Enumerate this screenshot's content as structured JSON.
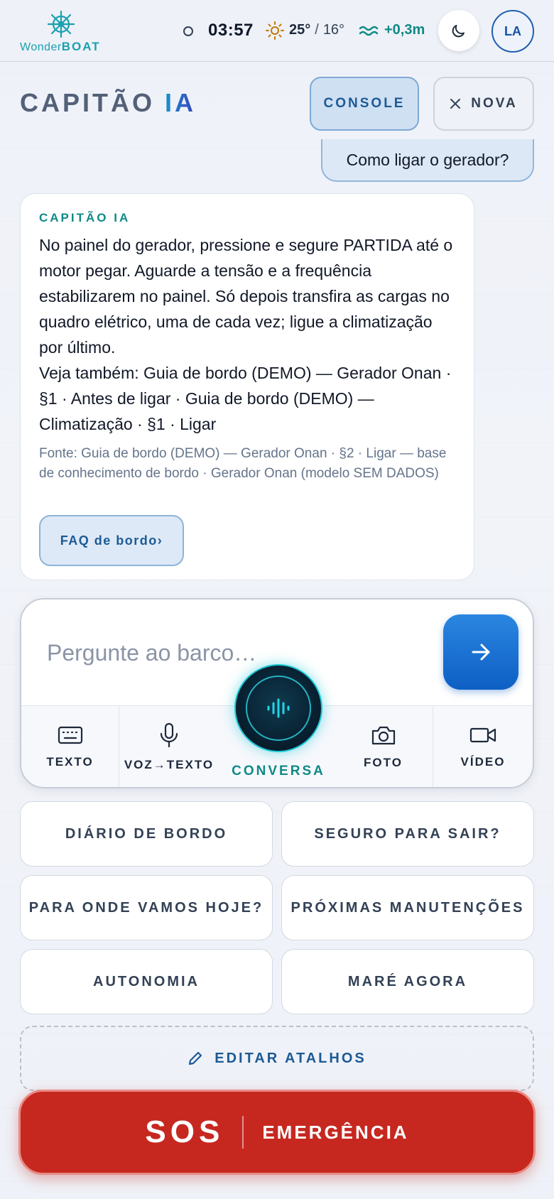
{
  "header": {
    "brand_prefix": "Wonder",
    "brand_suffix": "BOAT",
    "time": "03:57",
    "temp_high": "25°",
    "temp_sep": "/",
    "temp_low": "16°",
    "tide": "+0,3m",
    "avatar_initials": "LA",
    "icons": [
      "ship-wheel-icon",
      "status-dot-icon",
      "sun-icon",
      "wave-icon",
      "moon-icon"
    ]
  },
  "title_row": {
    "title_main": "CAPITÃO",
    "title_accent": "IA",
    "console_label": "CONSOLE",
    "new_label": "NOVA"
  },
  "chat": {
    "user_message": "Como ligar o gerador?",
    "assistant_name": "CAPITÃO IA",
    "assistant_text": "No painel do gerador, pressione e segure PARTIDA até o motor pegar. Aguarde a tensão e a frequência estabilizarem no painel. Só depois transfira as cargas no quadro elétrico, uma de cada vez; ligue a climatização por último.\nVeja também: Guia de bordo (DEMO) — Gerador Onan · §1 · Antes de ligar · Guia de bordo (DEMO) — Climatização · §1 · Ligar",
    "source": "Fonte: Guia de bordo (DEMO) — Gerador Onan · §2 · Ligar — base de conhecimento de bordo · Gerador Onan (modelo SEM DADOS)",
    "faq_label": "FAQ de bordo›"
  },
  "composer": {
    "placeholder": "Pergunte ao barco…",
    "modes": {
      "text": "TEXTO",
      "voice": "VOZ→TEXTO",
      "conversation": "CONVERSA",
      "photo": "FOTO",
      "video": "VÍDEO"
    }
  },
  "shortcuts": [
    "DIÁRIO DE BORDO",
    "SEGURO PARA SAIR?",
    "PARA ONDE VAMOS HOJE?",
    "PRÓXIMAS MANUTENÇÕES",
    "AUTONOMIA",
    "MARÉ AGORA"
  ],
  "edit_label": "EDITAR ATALHOS",
  "sos": {
    "big": "SOS",
    "small": "EMERGÊNCIA"
  },
  "colors": {
    "accent": "#0e5fc4",
    "teal": "#0f8a86",
    "danger": "#c62820"
  }
}
